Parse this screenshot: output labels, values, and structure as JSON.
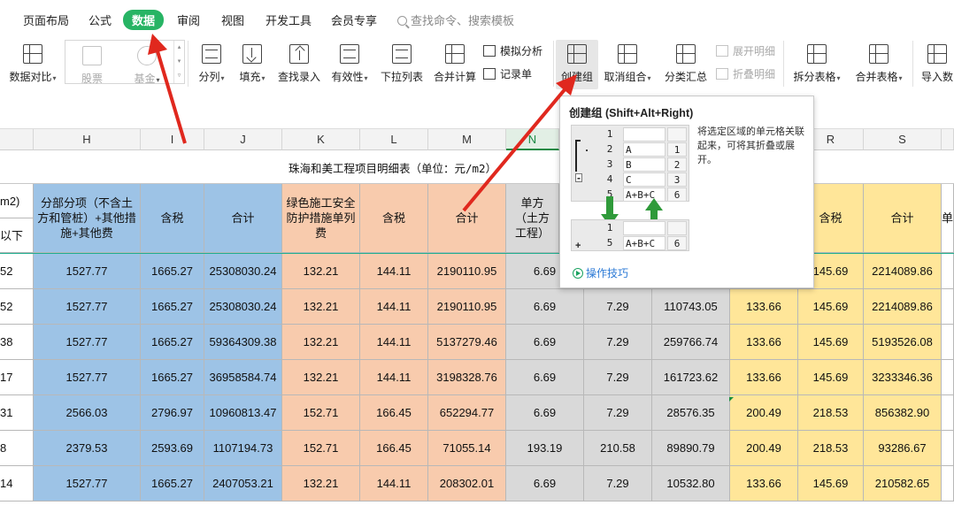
{
  "menu": {
    "items": [
      "页面布局",
      "公式",
      "数据",
      "审阅",
      "视图",
      "开发工具",
      "会员专享"
    ],
    "active": "数据",
    "search_placeholder": "查找命令、搜索模板"
  },
  "ribbon": {
    "data_compare": "数据对比",
    "stock": "股票",
    "fund": "基金",
    "split": "分列",
    "fill": "填充",
    "lookup_entry": "查找录入",
    "validity": "有效性",
    "dropdown_list": "下拉列表",
    "consolidate": "合并计算",
    "what_if": "模拟分析",
    "record_form": "记录单",
    "create_group": "创建组",
    "ungroup": "取消组合",
    "subtotal": "分类汇总",
    "expand_detail": "展开明细",
    "collapse_detail": "折叠明细",
    "split_table": "拆分表格",
    "merge_table": "合并表格",
    "import_data": "导入数"
  },
  "columns": [
    "H",
    "I",
    "J",
    "K",
    "L",
    "M",
    "N",
    "R",
    "S"
  ],
  "sheet": {
    "title": "珠海和美工程项目明细表（单位：元/m2）",
    "left_hdr_1": "m2)",
    "left_hdr_2": "以下",
    "header_blue_1": "分部分项（不含土方和管桩）+其他措施+其他费",
    "header_blue_2": "含税",
    "header_blue_3": "合计",
    "header_orange_1": "绿色施工安全防护措施单列费",
    "header_orange_2": "含税",
    "header_orange_3": "合计",
    "header_gray_1": "单方（土方工程）",
    "header_yellow_2": "含税",
    "header_yellow_3": "合计",
    "header_right": "单",
    "rows": [
      [
        "52",
        "1527.77",
        "1665.27",
        "25308030.24",
        "132.21",
        "144.11",
        "2190110.95",
        "6.69",
        "",
        "",
        "",
        "145.69",
        "2214089.86"
      ],
      [
        "52",
        "1527.77",
        "1665.27",
        "25308030.24",
        "132.21",
        "144.11",
        "2190110.95",
        "6.69",
        "7.29",
        "110743.05",
        "133.66",
        "145.69",
        "2214089.86"
      ],
      [
        "38",
        "1527.77",
        "1665.27",
        "59364309.38",
        "132.21",
        "144.11",
        "5137279.46",
        "6.69",
        "7.29",
        "259766.74",
        "133.66",
        "145.69",
        "5193526.08"
      ],
      [
        "17",
        "1527.77",
        "1665.27",
        "36958584.74",
        "132.21",
        "144.11",
        "3198328.76",
        "6.69",
        "7.29",
        "161723.62",
        "133.66",
        "145.69",
        "3233346.36"
      ],
      [
        "31",
        "2566.03",
        "2796.97",
        "10960813.47",
        "152.71",
        "166.45",
        "652294.77",
        "6.69",
        "7.29",
        "28576.35",
        "200.49",
        "218.53",
        "856382.90"
      ],
      [
        "8",
        "2379.53",
        "2593.69",
        "1107194.73",
        "152.71",
        "166.45",
        "71055.14",
        "193.19",
        "210.58",
        "89890.79",
        "200.49",
        "218.53",
        "93286.67"
      ],
      [
        "14",
        "1527.77",
        "1665.27",
        "2407053.21",
        "132.21",
        "144.11",
        "208302.01",
        "6.69",
        "7.29",
        "10532.80",
        "133.66",
        "145.69",
        "210582.65"
      ]
    ]
  },
  "tooltip": {
    "title": "创建组 (Shift+Alt+Right)",
    "description": "将选定区域的单元格关联起来，可将其折叠或展开。",
    "demo_rows": [
      [
        "1",
        "",
        ""
      ],
      [
        "2",
        "A",
        "1"
      ],
      [
        "3",
        "B",
        "2"
      ],
      [
        "4",
        "C",
        "3"
      ],
      [
        "5",
        "A+B+C",
        "6"
      ]
    ],
    "demo2_rows": [
      [
        "1",
        "",
        ""
      ],
      [
        "5",
        "A+B+C",
        "6"
      ]
    ],
    "bracket_dot": "·",
    "minus": "-",
    "plus": "+",
    "tip_link": "操作技巧"
  }
}
